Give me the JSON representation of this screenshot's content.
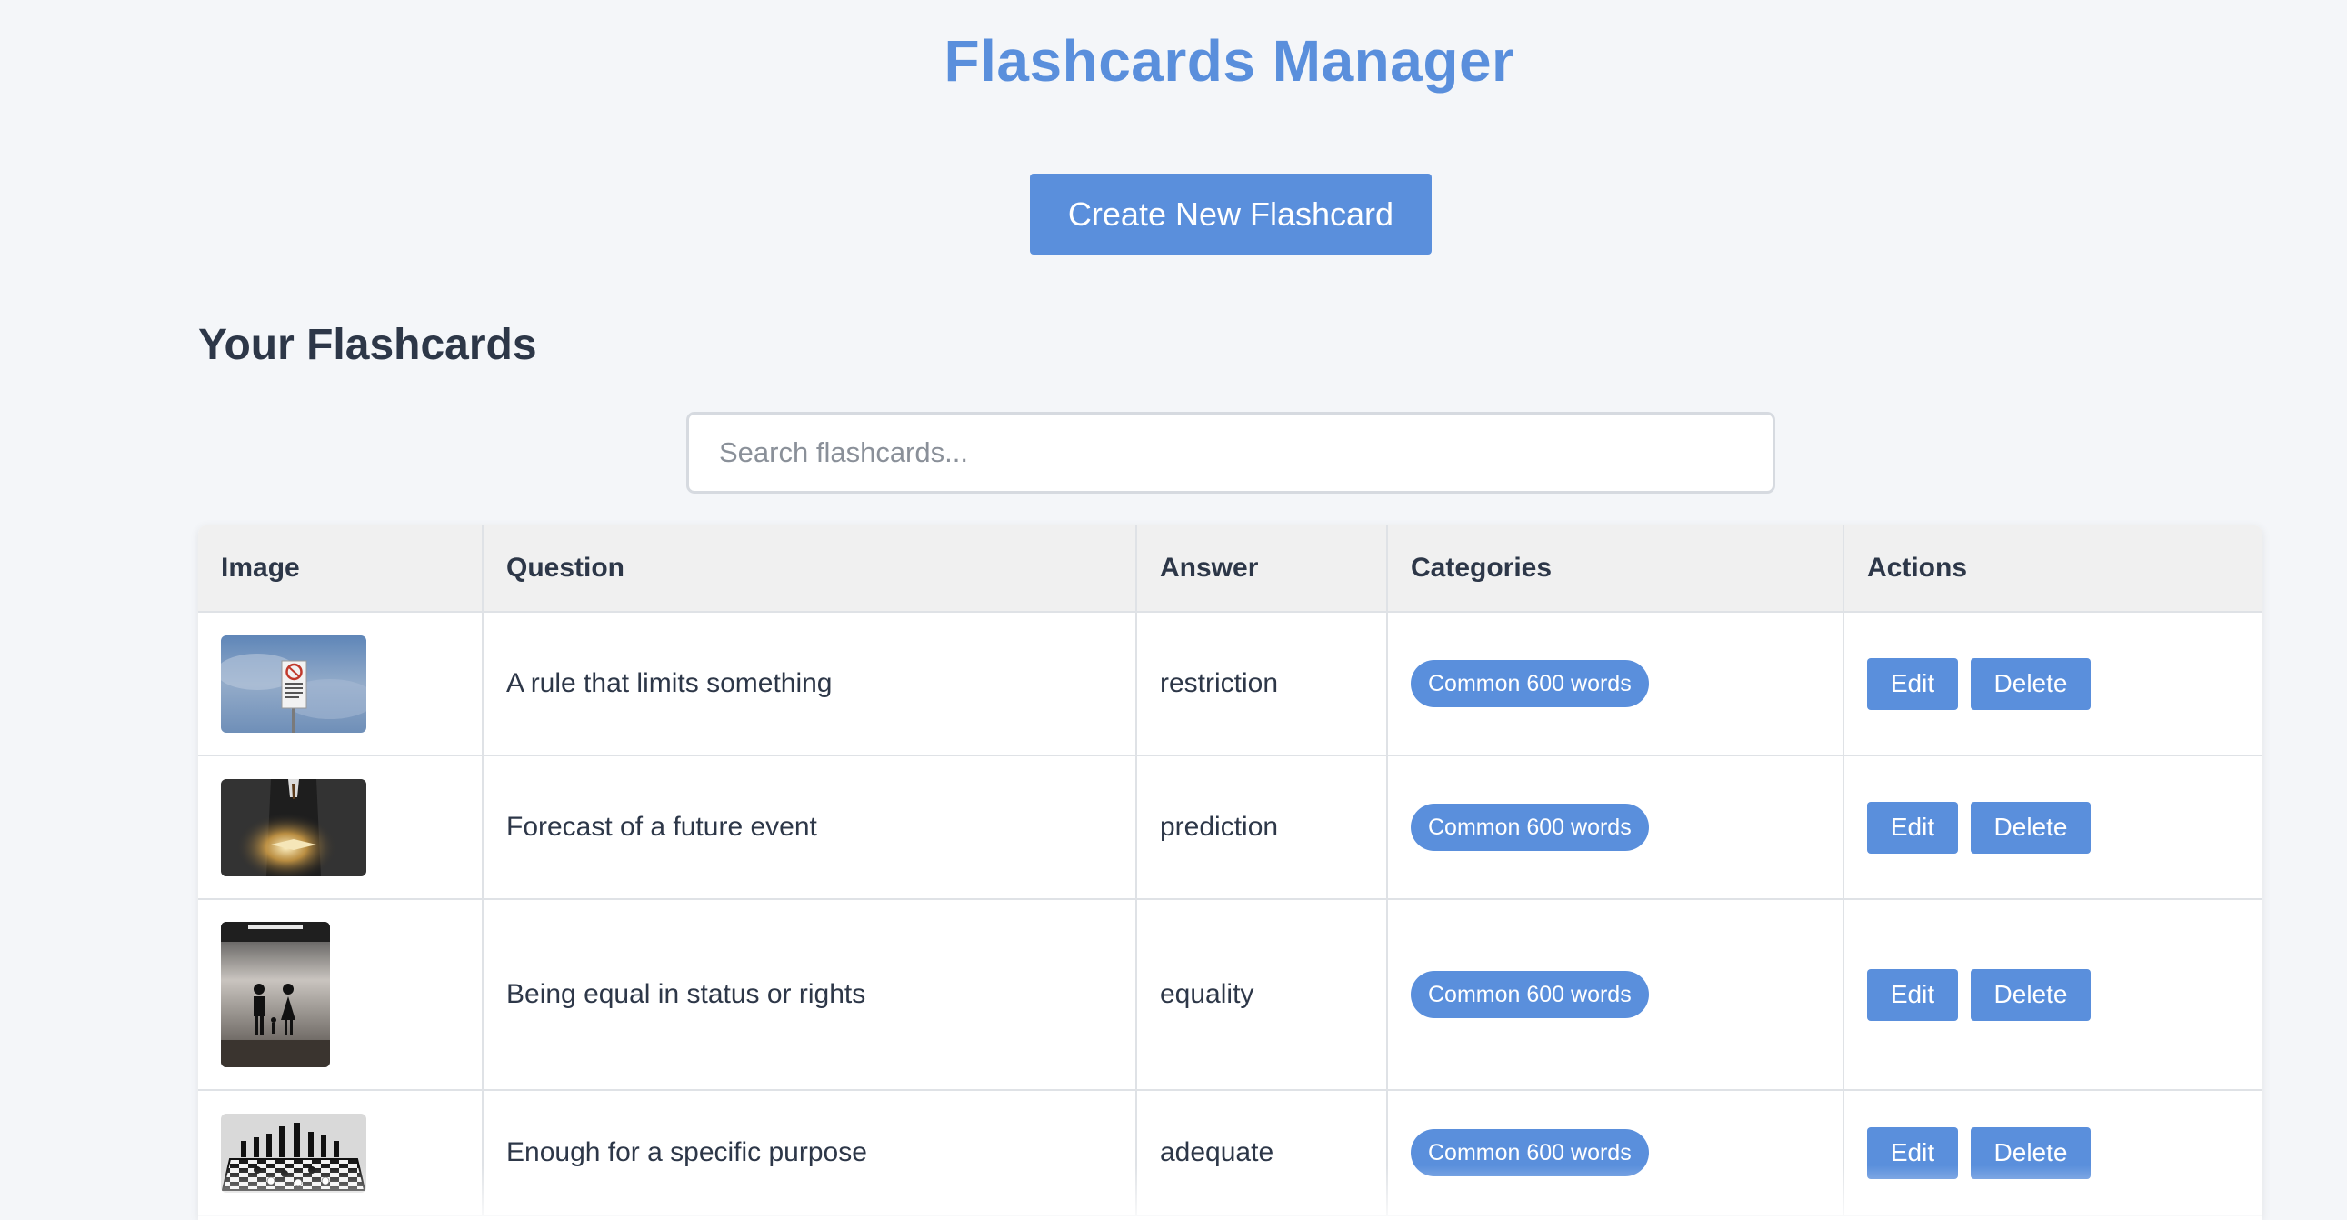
{
  "header": {
    "title": "Flashcards Manager"
  },
  "toolbar": {
    "create_label": "Create New Flashcard"
  },
  "section": {
    "title": "Your Flashcards"
  },
  "search": {
    "placeholder": "Search flashcards...",
    "value": ""
  },
  "table": {
    "columns": [
      "Image",
      "Question",
      "Answer",
      "Categories",
      "Actions"
    ],
    "rows": [
      {
        "image_icon": "no-parking-sign-image",
        "question": "A rule that limits something",
        "answer": "restriction",
        "category": "Common 600 words",
        "edit_label": "Edit",
        "delete_label": "Delete"
      },
      {
        "image_icon": "man-with-glowing-book-image",
        "question": "Forecast of a future event",
        "answer": "prediction",
        "category": "Common 600 words",
        "edit_label": "Edit",
        "delete_label": "Delete"
      },
      {
        "image_icon": "man-woman-restroom-sign-image",
        "question": "Being equal in status or rights",
        "answer": "equality",
        "category": "Common 600 words",
        "edit_label": "Edit",
        "delete_label": "Delete"
      },
      {
        "image_icon": "chess-board-image",
        "question": "Enough for a specific purpose",
        "answer": "adequate",
        "category": "Common 600 words",
        "edit_label": "Edit",
        "delete_label": "Delete"
      }
    ]
  },
  "colors": {
    "accent": "#5a8fdc",
    "background": "#f4f6f9",
    "text": "#2d3748",
    "header_row": "#f0f0f0"
  }
}
